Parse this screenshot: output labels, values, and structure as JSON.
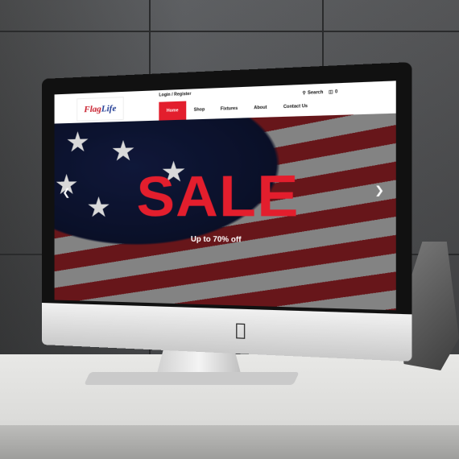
{
  "site": {
    "logo": {
      "part1": "Flag",
      "part2": "Life"
    },
    "login": "Login / Register",
    "nav": {
      "items": [
        "Home",
        "Shop",
        "Fixtures",
        "About",
        "Contact Us"
      ],
      "active_index": 0
    },
    "search_label": "Search",
    "cart_count": "0"
  },
  "hero": {
    "headline": "SALE",
    "subline": "Up to 70% off"
  },
  "icons": {
    "search": "magnifier-icon",
    "cart": "cart-icon",
    "prev": "chevron-left-icon",
    "next": "chevron-right-icon",
    "apple": "apple-logo-icon"
  },
  "colors": {
    "accent": "#e31e2d",
    "flag_red": "#c81d2b",
    "flag_blue": "#1f3a93"
  }
}
